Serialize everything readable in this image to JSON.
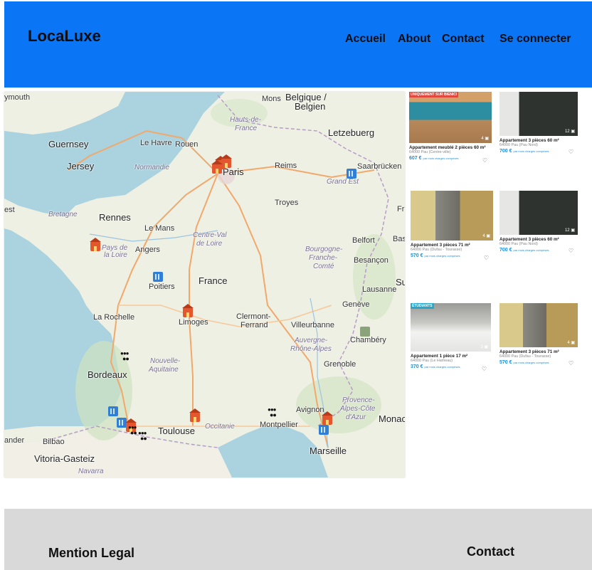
{
  "header": {
    "brand": "LocaLuxe",
    "nav": [
      "Accueil",
      "About",
      "Contact",
      "Se connecter"
    ],
    "color": "#0a75f5"
  },
  "map": {
    "labels": [
      "Belgique /",
      "Belgien",
      "Letzebuerg",
      "Hauts-de-",
      "France",
      "Mons",
      "Guernsey",
      "Jersey",
      "Le Havre",
      "Rouen",
      "Normandie",
      "Paris",
      "Reims",
      "Saarbrücken",
      "Grand Est",
      "Troyes",
      "Bretagne",
      "Rennes",
      "Le Mans",
      "Centre-Val",
      "de Loire",
      "Pays de",
      "la Loire",
      "Angers",
      "Belfort",
      "Bourgogne-",
      "Franche-",
      "Comté",
      "Besançon",
      "Lausanne",
      "Poitiers",
      "France",
      "Genève",
      "La Rochelle",
      "Limoges",
      "Clermont-",
      "Ferrand",
      "Villeurbanne",
      "Auvergne-",
      "Rhône-Alpes",
      "Chambéry",
      "Bordeaux",
      "Nouvelle-",
      "Aquitaine",
      "Grenoble",
      "Provence-",
      "Alpes-Côte",
      "d'Azur",
      "Avignon",
      "Monaco",
      "Toulouse",
      "Occitanie",
      "Montpellier",
      "Marseille",
      "Bilbao",
      "Vitoria-Gasteiz",
      "Navarra",
      "ymouth",
      "est",
      "Fr",
      "Bas",
      "Su",
      "ander"
    ]
  },
  "listings": [
    {
      "badge": "UNIQUEMENT SUR BIENICI",
      "title": "Appartement meublé 2 pièces 60 m²",
      "location": "64000 Pau (Centre-ville)",
      "price": "607 €",
      "price_note": "par mois charges comprises",
      "photos": "4"
    },
    {
      "badge": "",
      "title": "Appartement 3 pièces 60 m²",
      "location": "64000 Pau (Pau Nord)",
      "price": "700 €",
      "price_note": "par mois charges comprises",
      "photos": "12"
    },
    {
      "badge": "",
      "title": "Appartement 3 pièces 71 m²",
      "location": "64000 Pau (Dufau - Tourasse)",
      "price": "570 €",
      "price_note": "par mois charges comprises",
      "photos": "4"
    },
    {
      "badge": "",
      "title": "Appartement 3 pièces 60 m²",
      "location": "64000 Pau (Pau Nord)",
      "price": "700 €",
      "price_note": "par mois charges comprises",
      "photos": "12"
    },
    {
      "badge": "ÉTUDIANTS",
      "title": "Appartement 1 pièce 17 m²",
      "location": "64000 Pau (Le Hameau)",
      "price": "370 €",
      "price_note": "par mois charges comprises",
      "photos": "3"
    },
    {
      "badge": "",
      "title": "Appartement 3 pièces 71 m²",
      "location": "64000 Pau (Dufau - Tourasse)",
      "price": "570 €",
      "price_note": "par mois charges comprises",
      "photos": "4"
    }
  ],
  "footer": {
    "legal": "Mention Legal",
    "contact": "Contact",
    "background": "#d9d9d9"
  }
}
